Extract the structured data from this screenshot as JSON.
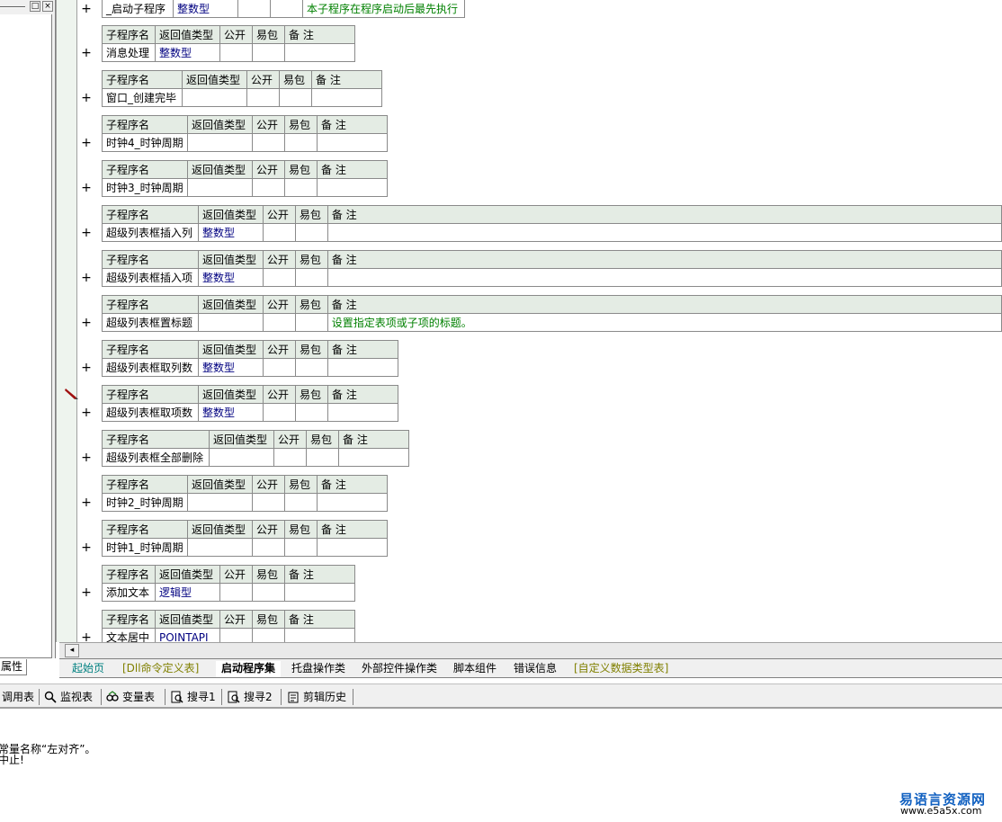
{
  "left_panel": {
    "buttons": [
      "□",
      "×"
    ],
    "tab_label": "属性"
  },
  "header": {
    "col_name": "子程序名",
    "col_return": "返回值类型",
    "col_public": "公开",
    "col_easy": "易包",
    "col_note": "备 注"
  },
  "first_row": {
    "name": "_启动子程序",
    "type": "整数型",
    "note": "本子程序在程序启动后最先执行"
  },
  "subs": [
    {
      "name": "消息处理",
      "type": "整数型",
      "note": ""
    },
    {
      "name": "窗口_创建完毕",
      "type": "",
      "note": ""
    },
    {
      "name": "时钟4_时钟周期",
      "type": "",
      "note": ""
    },
    {
      "name": "时钟3_时钟周期",
      "type": "",
      "note": ""
    },
    {
      "name": "超级列表框插入列",
      "type": "整数型",
      "note": ""
    },
    {
      "name": "超级列表框插入项",
      "type": "整数型",
      "note": ""
    },
    {
      "name": "超级列表框置标题",
      "type": "",
      "note": "设置指定表项或子项的标题。"
    },
    {
      "name": "超级列表框取列数",
      "type": "整数型",
      "note": ""
    },
    {
      "name": "超级列表框取项数",
      "type": "整数型",
      "note": ""
    },
    {
      "name": "超级列表框全部删除",
      "type": "",
      "note": ""
    },
    {
      "name": "时钟2_时钟周期",
      "type": "",
      "note": ""
    },
    {
      "name": "时钟1_时钟周期",
      "type": "",
      "note": ""
    },
    {
      "name": "添加文本",
      "type": "逻辑型",
      "note": ""
    },
    {
      "name": "文本居中",
      "type": "POINTAPI",
      "note": ""
    }
  ],
  "plus_sign": "+",
  "doc_tabs": [
    {
      "label": "起始页",
      "color": "#008080"
    },
    {
      "label": "[Dll命令定义表]",
      "color": "#808000"
    },
    {
      "label": "启动程序集",
      "color": "#000000"
    },
    {
      "label": "托盘操作类",
      "color": "#000000"
    },
    {
      "label": "外部控件操作类",
      "color": "#000000"
    },
    {
      "label": "脚本组件",
      "color": "#000000"
    },
    {
      "label": "错误信息",
      "color": "#000000"
    },
    {
      "label": "[自定义数据类型表]",
      "color": "#808000"
    }
  ],
  "bottom_tools": [
    "调用表",
    "监视表",
    "变量表",
    "搜寻1",
    "搜寻2",
    "剪辑历史"
  ],
  "output_lines": [
    "常量名称“左对齐”。",
    "中止!"
  ],
  "watermark": {
    "cn": "易语言资源网",
    "url": "www.e5a5x.com"
  }
}
